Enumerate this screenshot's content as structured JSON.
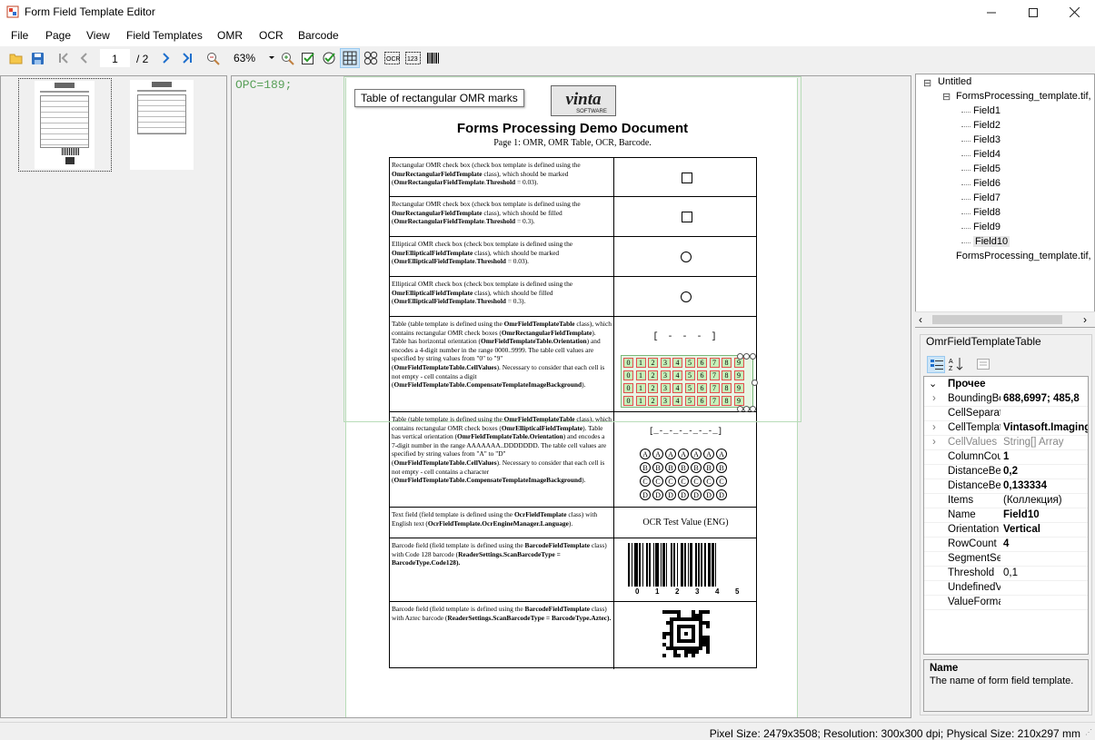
{
  "window": {
    "title": "Form Field Template Editor"
  },
  "menu": [
    "File",
    "Page",
    "View",
    "Field Templates",
    "OMR",
    "OCR",
    "Barcode"
  ],
  "toolbar": {
    "page_current": "1",
    "page_total": "/ 2",
    "zoom": "63%"
  },
  "viewer": {
    "opc": "OPC=189;",
    "tooltip": "Table of rectangular OMR marks"
  },
  "document": {
    "logo_text": "vinta",
    "logo_sub": "SOFTWARE",
    "title": "Forms Processing Demo Document",
    "subtitle": "Page 1: OMR, OMR Table, OCR, Barcode.",
    "rows": [
      {
        "text": "Rectangular OMR check box (check box template is defined using the <b>OmrRectangularFieldTemplate</b> class), which should be marked (<b>OmrRectangularFieldTemplate</b>.<b>Threshold</b> = 0.03)."
      },
      {
        "text": "Rectangular OMR check box (check box template is defined using the <b>OmrRectangularFieldTemplate</b> class), which should be filled (<b>OmrRectangularFieldTemplate</b>.<b>Threshold</b> = 0.3)."
      },
      {
        "text": "Elliptical OMR check box (check box template is defined using the <b>OmrEllipticalFieldTemplate</b> class), which should be marked (<b>OmrEllipticalFieldTemplate</b>.<b>Threshold</b> = 0.03)."
      },
      {
        "text": "Elliptical OMR check box (check box template is defined using the <b>OmrEllipticalFieldTemplate</b> class), which should be filled (<b>OmrEllipticalFieldTemplate</b>.<b>Threshold</b> = 0.3)."
      },
      {
        "text": "Table (table template is defined using the <b>OmrFieldTemplateTable</b> class), which contains rectangular OMR check boxes (<b>OmrRectangularFieldTemplate</b>). Table has horizontal orientation (<b>OmrFieldTemplateTable.Orientation</b>) and encodes a 4-digit number in the range 0000..9999. The table cell values are specified by string values from \"0\" to \"9\" (<b>OmrFieldTemplateTable.CellValues</b>). Necessary to consider that each cell is not empty - cell contains a digit (<b>OmrFieldTemplateTable.CompensateTemplateImageBackground</b>)."
      },
      {
        "text": "Table (table template is defined using the <b>OmrFieldTemplateTable</b> class), which contains rectangular OMR check boxes (<b>OmrEllipticalFieldTemplate</b>). Table has vertical orientation (<b>OmrFieldTemplateTable.Orientation</b>) and encodes a 7-digit number in the range AAAAAAA..DDDDDDD. The table cell values are specified by string values from \"A\" to \"D\" (<b>OmrFieldTemplateTable.CellValues</b>). Necessary to consider that each cell is not empty - cell contains a character (<b>OmrFieldTemplateTable.CompensateTemplateImageBackground</b>)."
      },
      {
        "text": "Text field (field template is defined using the <b>OcrFieldTemplate</b> class) with English text (<b>OcrFieldTemplate.OcrEngineManager.Language</b>)."
      },
      {
        "text": "Barcode field (field template is defined using the <b>BarcodeFieldTemplate</b> class) with Code 128 barcode (<b>ReaderSettings.ScanBarcodeType = BarcodeType.Code128).</b>"
      },
      {
        "text": "Barcode field (field template is defined using the <b>BarcodeFieldTemplate</b> class) with Aztec barcode (<b>ReaderSettings.ScanBarcodeType = BarcodeType.Aztec).</b>"
      }
    ],
    "digit_bracket": "[ - - - ]",
    "digits": [
      "0",
      "1",
      "2",
      "3",
      "4",
      "5",
      "6",
      "7",
      "8",
      "9"
    ],
    "letter_bracket": "[_-_-_-_-_-_-_]",
    "letters": [
      "A",
      "B",
      "C",
      "D"
    ],
    "ocr_value": "OCR Test Value (ENG)",
    "barcode_digits": [
      "0",
      "1",
      "2",
      "3",
      "4",
      "5"
    ]
  },
  "tree": {
    "root": "Untitled",
    "file1": "FormsProcessing_template.tif, Pa",
    "fields": [
      "Field1",
      "Field2",
      "Field3",
      "Field4",
      "Field5",
      "Field6",
      "Field7",
      "Field8",
      "Field9",
      "Field10"
    ],
    "file2": "FormsProcessing_template.tif, Pa"
  },
  "props": {
    "title": "OmrFieldTemplateTable",
    "category": "Прочее",
    "rows": [
      {
        "name": "BoundingBo",
        "value": "688,6997; 485,8",
        "bold": true,
        "exp": true
      },
      {
        "name": "CellSeparat",
        "value": "",
        "bold": false,
        "exp": false
      },
      {
        "name": "CellTemplat",
        "value": "Vintasoft.Imaging",
        "bold": true,
        "exp": true
      },
      {
        "name": "CellValues",
        "value": "String[] Array",
        "bold": false,
        "exp": true,
        "gray": true
      },
      {
        "name": "ColumnCour",
        "value": "1",
        "bold": true,
        "exp": false
      },
      {
        "name": "DistanceBe",
        "value": "0,2",
        "bold": true,
        "exp": false
      },
      {
        "name": "DistanceBe",
        "value": "0,133334",
        "bold": true,
        "exp": false
      },
      {
        "name": "Items",
        "value": "(Коллекция)",
        "bold": false,
        "exp": false
      },
      {
        "name": "Name",
        "value": "Field10",
        "bold": true,
        "exp": false
      },
      {
        "name": "Orientation",
        "value": "Vertical",
        "bold": true,
        "exp": false
      },
      {
        "name": "RowCount",
        "value": "4",
        "bold": true,
        "exp": false
      },
      {
        "name": "SegmentSe",
        "value": "",
        "bold": false,
        "exp": false
      },
      {
        "name": "Threshold",
        "value": "0,1",
        "bold": false,
        "exp": false
      },
      {
        "name": "UndefinedV",
        "value": "",
        "bold": false,
        "exp": false
      },
      {
        "name": "ValueForma",
        "value": "",
        "bold": false,
        "exp": false
      }
    ],
    "desc_title": "Name",
    "desc_text": "The name of form field template."
  },
  "status": "Pixel Size: 2479x3508; Resolution: 300x300 dpi; Physical Size: 210x297 mm",
  "colors": {
    "accent": "#1e6fcc",
    "selection": "#cce4f7",
    "green": "#5aa05a",
    "omr_cell": "#c6f0b8",
    "omr_cell_border": "#e35050"
  }
}
